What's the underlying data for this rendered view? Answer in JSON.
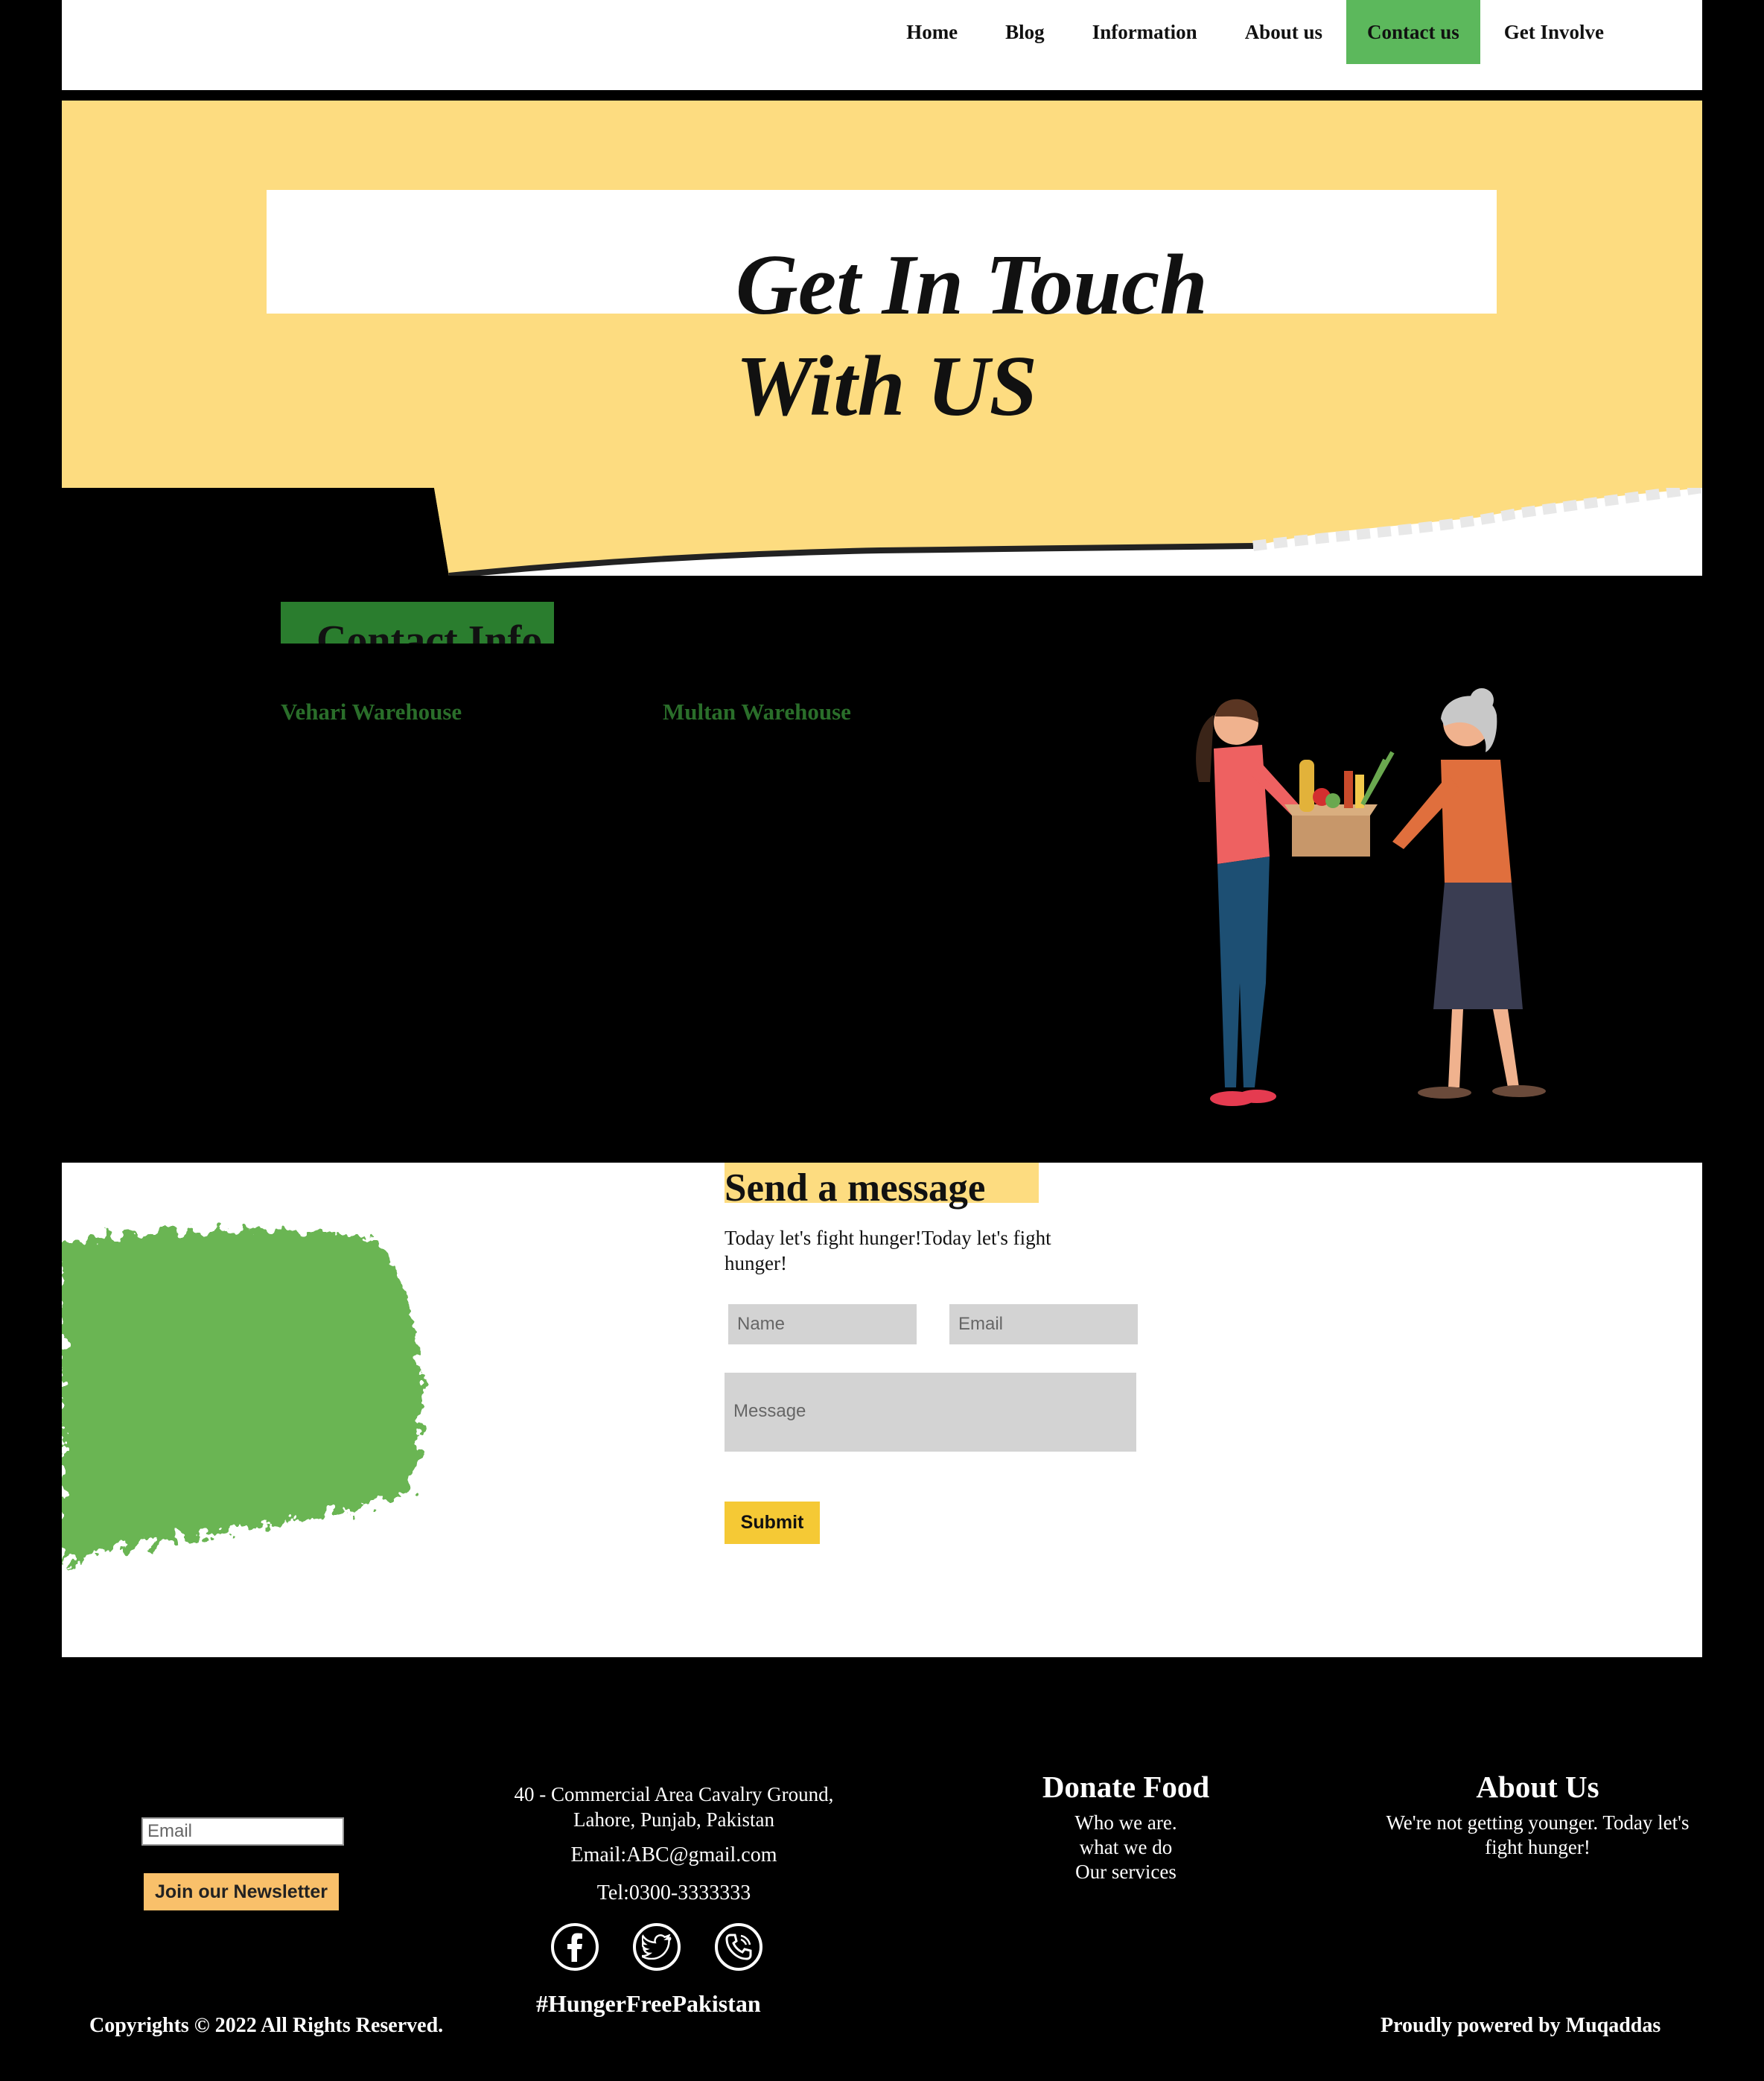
{
  "nav": {
    "items": [
      {
        "label": "Home"
      },
      {
        "label": "Blog"
      },
      {
        "label": "Information"
      },
      {
        "label": "About us"
      },
      {
        "label": "Contact us",
        "active": true
      },
      {
        "label": "Get Involve"
      }
    ]
  },
  "hero": {
    "title": "Get In Touch\nWith US"
  },
  "contact_info": {
    "heading": "Contact Info",
    "warehouses": [
      "Vehari Warehouse",
      "Multan Warehouse"
    ]
  },
  "message": {
    "title": "Send a message",
    "subtitle": "Today let's fight hunger!Today let's fight hunger!",
    "name_placeholder": "Name",
    "email_placeholder": "Email",
    "message_placeholder": "Message",
    "submit_label": "Submit"
  },
  "footer": {
    "email_placeholder": "Email",
    "newsletter_label": "Join our Newsletter",
    "address": "40 - Commercial Area Cavalry Ground, Lahore, Punjab, Pakistan",
    "email": "Email:ABC@gmail.com",
    "tel": "Tel:0300-3333333",
    "donate_heading": "Donate Food",
    "donate_links": [
      "Who we are.",
      "what we do",
      "Our services"
    ],
    "about_heading": "About Us",
    "about_text": "We're not getting younger. Today let's fight hunger!",
    "hashtag": "#HungerFreePakistan",
    "copyright": "Copyrights © 2022 All Rights Reserved.",
    "powered": "Proudly powered by Muqaddas",
    "socials": [
      "facebook-icon",
      "twitter-icon",
      "phone-icon"
    ]
  },
  "colors": {
    "hero_bg": "#fddc80",
    "active_nav": "#5cb85c",
    "contact_heading_bg": "#2a7d2e",
    "submit": "#f5c935",
    "newsletter": "#f9c06a"
  }
}
